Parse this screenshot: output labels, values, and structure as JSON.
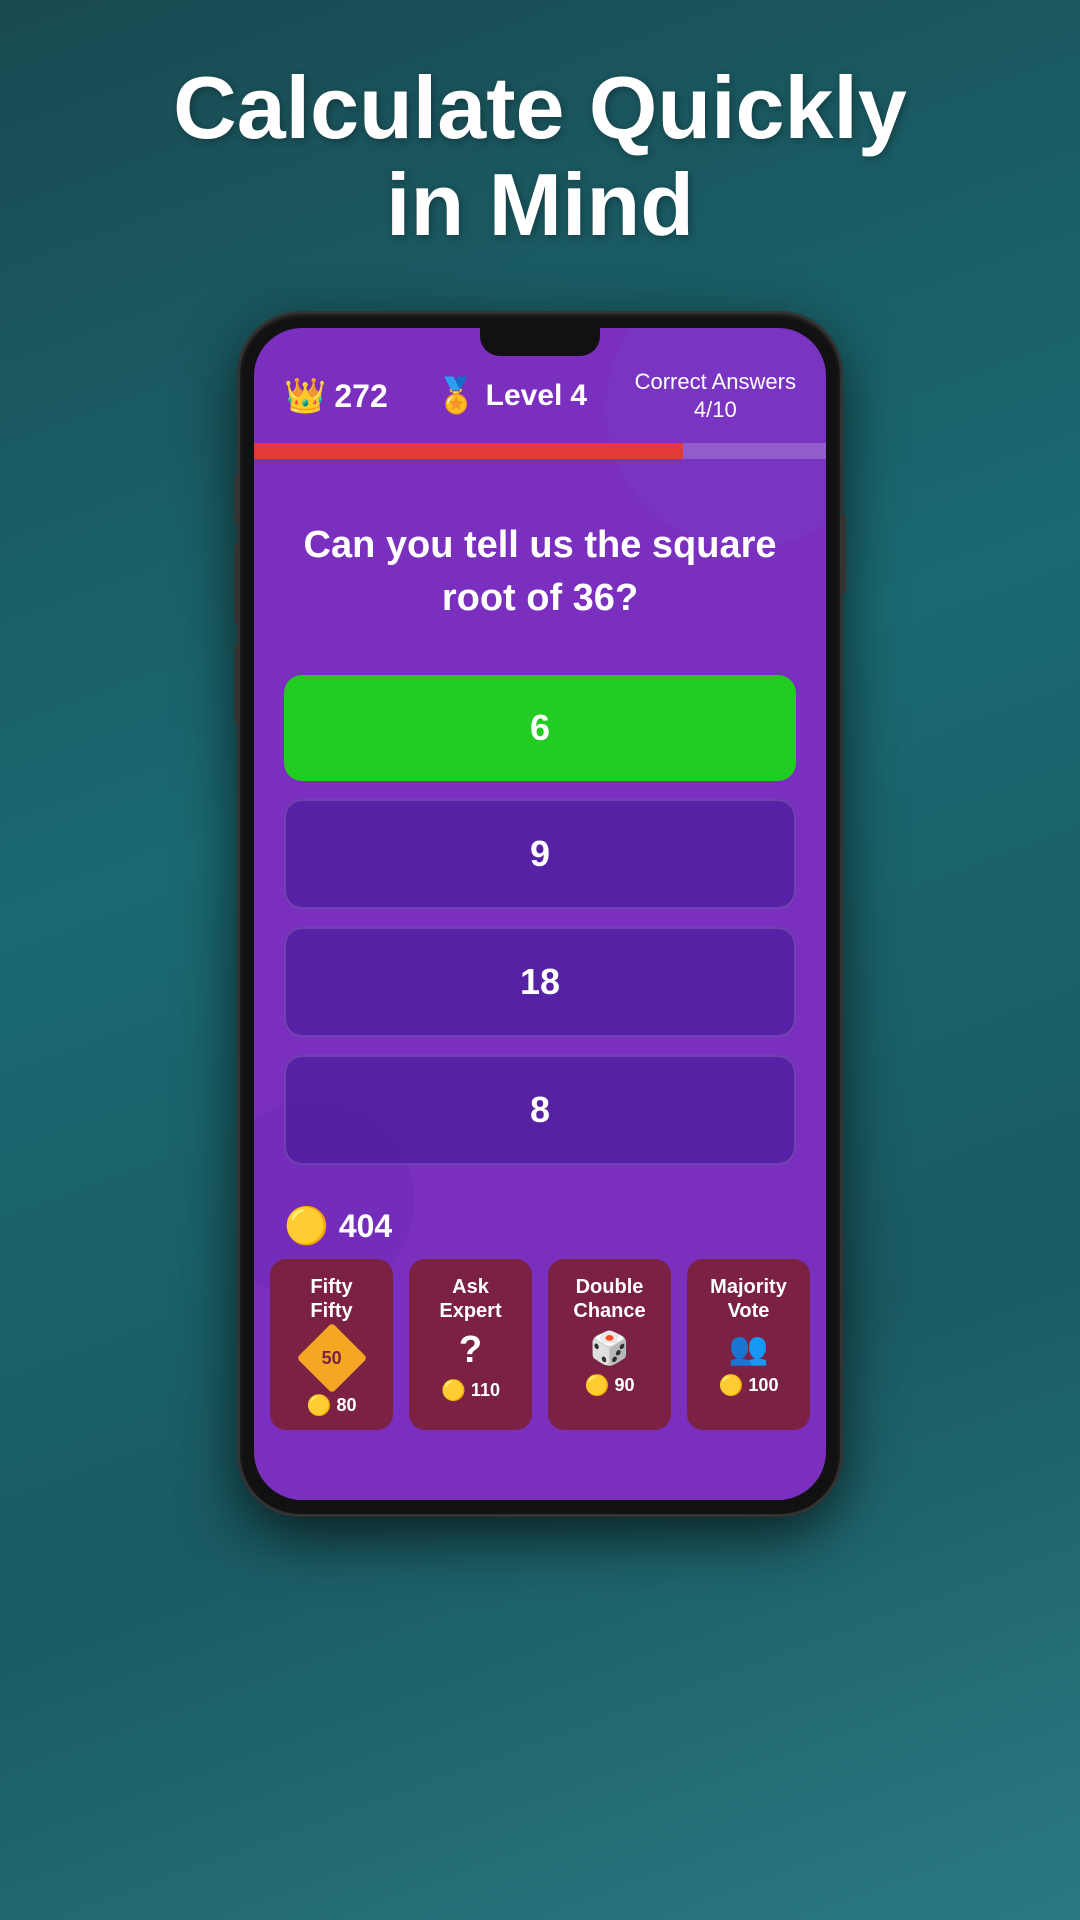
{
  "page": {
    "title_line1": "Calculate Quickly",
    "title_line2": "in Mind"
  },
  "header": {
    "score": "272",
    "level_label": "Level",
    "level_number": "4",
    "correct_answers_label": "Correct Answers",
    "correct_answers_value": "4/10",
    "progress_percent": 75
  },
  "question": {
    "text": "Can you tell us the square root of 36?"
  },
  "answers": [
    {
      "id": "a",
      "text": "6",
      "type": "correct"
    },
    {
      "id": "b",
      "text": "9",
      "type": "default"
    },
    {
      "id": "c",
      "text": "18",
      "type": "default"
    },
    {
      "id": "d",
      "text": "8",
      "type": "default"
    }
  ],
  "coins": {
    "amount": "404",
    "icon": "🟡"
  },
  "lifelines": [
    {
      "id": "fifty-fifty",
      "name_line1": "Fifty",
      "name_line2": "Fifty",
      "icon": "50",
      "cost": "80"
    },
    {
      "id": "ask-expert",
      "name_line1": "Ask",
      "name_line2": "Expert",
      "icon": "?",
      "cost": "110"
    },
    {
      "id": "double-chance",
      "name_line1": "Double",
      "name_line2": "Chance",
      "icon": "🎲",
      "cost": "90"
    },
    {
      "id": "majority-vote",
      "name_line1": "Majority",
      "name_line2": "Vote",
      "icon": "👥",
      "cost": "100"
    }
  ]
}
